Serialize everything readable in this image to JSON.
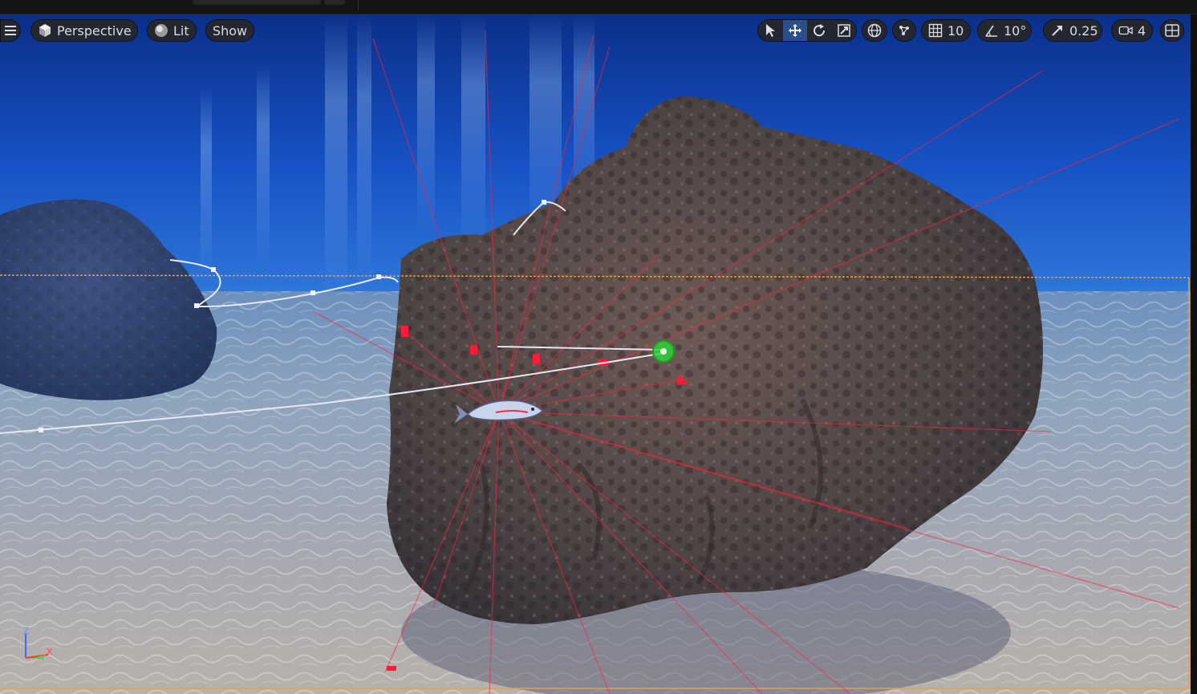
{
  "toolbar": {
    "view_mode": "Perspective",
    "lighting_mode": "Lit",
    "show_label": "Show",
    "grid_snap_value": "10",
    "rotation_snap_value": "10°",
    "scale_snap_value": "0.25",
    "camera_speed_value": "4"
  },
  "icons": {
    "menu": "hamburger-icon",
    "perspective": "cube-icon",
    "lit": "sphere-icon",
    "select": "cursor-icon",
    "translate": "move-arrows-icon",
    "rotate": "rotate-icon",
    "scale": "scale-icon",
    "world_local": "globe-icon",
    "surface_snap": "surface-snap-icon",
    "grid": "grid-icon",
    "angle": "angle-icon",
    "scale_snap": "scale-arrow-icon",
    "camera": "camera-icon",
    "layout": "viewport-layout-icon"
  },
  "axis_gizmo": {
    "z": "Z",
    "y": "Y",
    "x": "X"
  },
  "colors": {
    "accent_active": "#2c4f8c",
    "selection_outline": "#e8a23a",
    "spline": "#e8e8f0",
    "debug_lines": "#ff2040",
    "target_marker": "#2fd23a"
  }
}
